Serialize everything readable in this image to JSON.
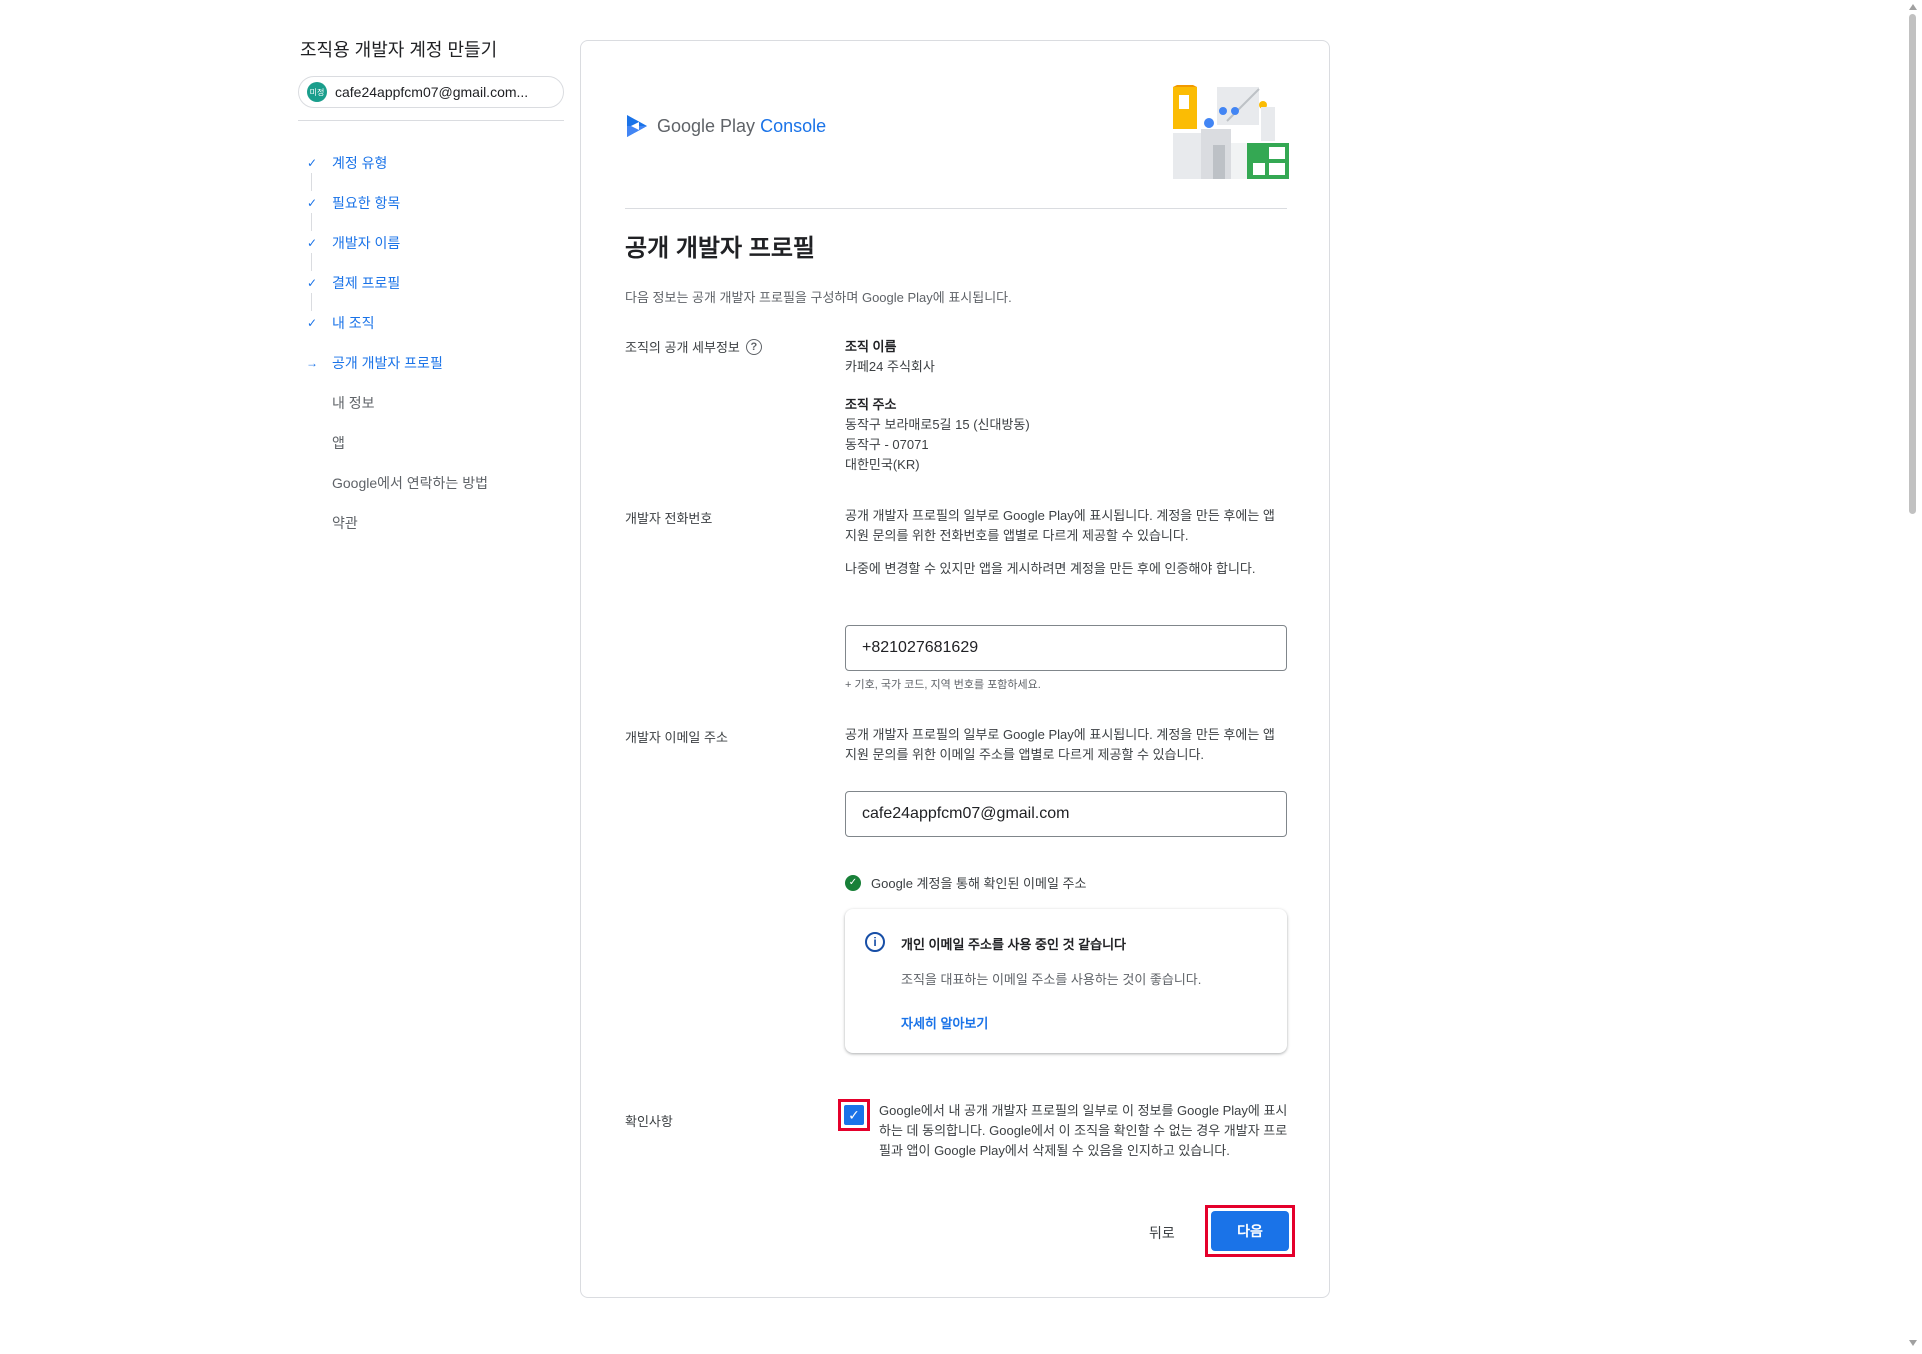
{
  "sidebar": {
    "title": "조직용 개발자 계정 만들기",
    "account": {
      "avatar_text": "미정",
      "email": "cafe24appfcm07@gmail.com..."
    },
    "steps": [
      {
        "label": "계정 유형",
        "state": "done"
      },
      {
        "label": "필요한 항목",
        "state": "done"
      },
      {
        "label": "개발자 이름",
        "state": "done"
      },
      {
        "label": "결제 프로필",
        "state": "done"
      },
      {
        "label": "내 조직",
        "state": "done"
      },
      {
        "label": "공개 개발자 프로필",
        "state": "current"
      },
      {
        "label": "내 정보",
        "state": "todo"
      },
      {
        "label": "앱",
        "state": "todo"
      },
      {
        "label": "Google에서 연락하는 방법",
        "state": "todo"
      },
      {
        "label": "약관",
        "state": "todo"
      }
    ]
  },
  "logo": {
    "google_play": "Google Play",
    "console": "Console"
  },
  "page": {
    "title": "공개 개발자 프로필",
    "intro": "다음 정보는 공개 개발자 프로필을 구성하며 Google Play에 표시됩니다."
  },
  "org_details": {
    "label": "조직의 공개 세부정보",
    "help_icon": "question-circle-icon",
    "name_title": "조직 이름",
    "name_value": "카페24 주식회사",
    "address_title": "조직 주소",
    "address_lines": [
      "동작구 보라매로5길 15 (신대방동)",
      "동작구 - 07071",
      "대한민국(KR)"
    ]
  },
  "phone": {
    "label": "개발자 전화번호",
    "desc1": "공개 개발자 프로필의 일부로 Google Play에 표시됩니다. 계정을 만든 후에는 앱 지원 문의를 위한 전화번호를 앱별로 다르게 제공할 수 있습니다.",
    "desc2": "나중에 변경할 수 있지만 앱을 게시하려면 계정을 만든 후에 인증해야 합니다.",
    "value": "+821027681629",
    "hint": "+ 기호, 국가 코드, 지역 번호를 포함하세요."
  },
  "email": {
    "label": "개발자 이메일 주소",
    "desc": "공개 개발자 프로필의 일부로 Google Play에 표시됩니다. 계정을 만든 후에는 앱 지원 문의를 위한 이메일 주소를 앱별로 다르게 제공할 수 있습니다.",
    "value": "cafe24appfcm07@gmail.com",
    "verified_text": "Google 계정을 통해 확인된 이메일 주소",
    "notice_title": "개인 이메일 주소를 사용 중인 것 같습니다",
    "notice_body": "조직을 대표하는 이메일 주소를 사용하는 것이 좋습니다.",
    "notice_link": "자세히 알아보기"
  },
  "consent": {
    "label": "확인사항",
    "checked": true,
    "text": "Google에서 내 공개 개발자 프로필의 일부로 이 정보를 Google Play에 표시하는 데 동의합니다. Google에서 이 조직을 확인할 수 없는 경우 개발자 프로필과 앱이 Google Play에서 삭제될 수 있음을 인지하고 있습니다."
  },
  "actions": {
    "back": "뒤로",
    "next": "다음"
  },
  "colors": {
    "accent": "#1a73e8",
    "highlight": "#e4002b",
    "success": "#188038"
  }
}
